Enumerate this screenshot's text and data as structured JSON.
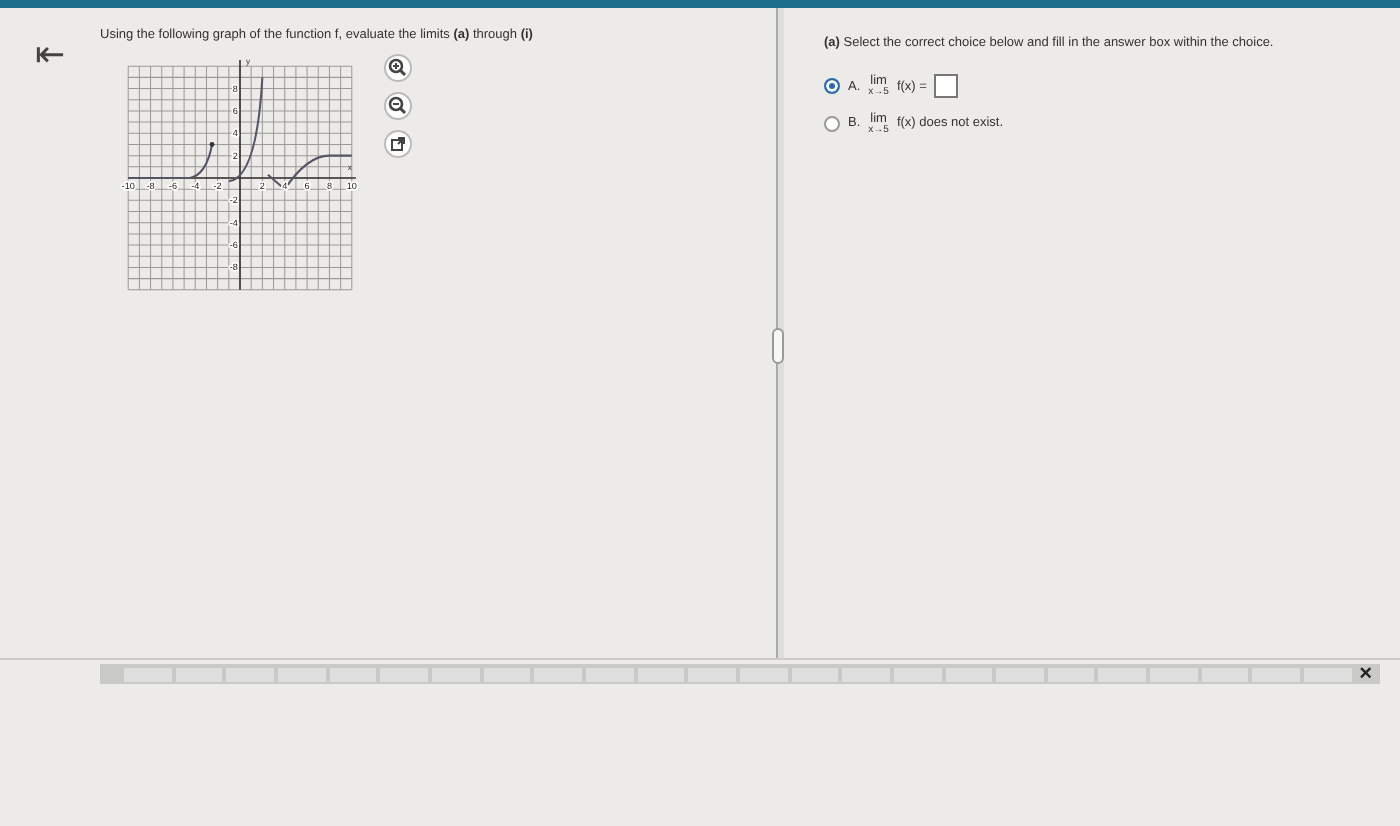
{
  "back_button": {
    "label": "⇤"
  },
  "question": {
    "prompt": "Using the following graph of the function f, evaluate the limits **(a)** through **(i)**",
    "graph": {
      "x_tick_labels": [
        "-10",
        "-8",
        "-6",
        "-4",
        "-2",
        "2",
        "4",
        "6",
        "8",
        "10"
      ],
      "y_tick_labels": [
        "8",
        "6",
        "4",
        "2",
        "-2",
        "-4",
        "-6",
        "-8"
      ],
      "x_axis_label": "x",
      "y_axis_label": "y"
    }
  },
  "part": {
    "instruction": "**(a)** Select the correct choice below and fill in the answer box within the choice.",
    "choices": [
      {
        "letter": "A.",
        "lim": "lim",
        "under": "x→5",
        "expr": "f(x) =",
        "answer_box": true,
        "selected": true
      },
      {
        "letter": "B.",
        "lim": "lim",
        "under": "x→5",
        "expr": "f(x) does not exist.",
        "answer_box": false,
        "selected": false
      }
    ]
  },
  "toolbar": {
    "close": "×"
  }
}
